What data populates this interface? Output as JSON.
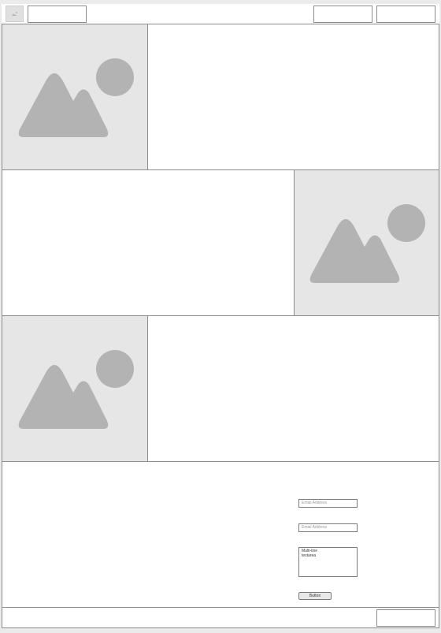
{
  "header": {
    "logo_icon": "image-placeholder-icon"
  },
  "hero_rows": [
    {
      "image": "image-placeholder-icon"
    },
    {
      "image": "image-placeholder-icon"
    },
    {
      "image": "image-placeholder-icon"
    }
  ],
  "form": {
    "email_placeholder_1": "Email Address",
    "email_placeholder_2": "Email Address",
    "textarea_value": "Multi-line\ntextarea",
    "button_label": "Button"
  },
  "colors": {
    "placeholder_fill": "#b3b3b3",
    "panel_bg": "#e6e6e6",
    "border": "#8c8c8c"
  }
}
